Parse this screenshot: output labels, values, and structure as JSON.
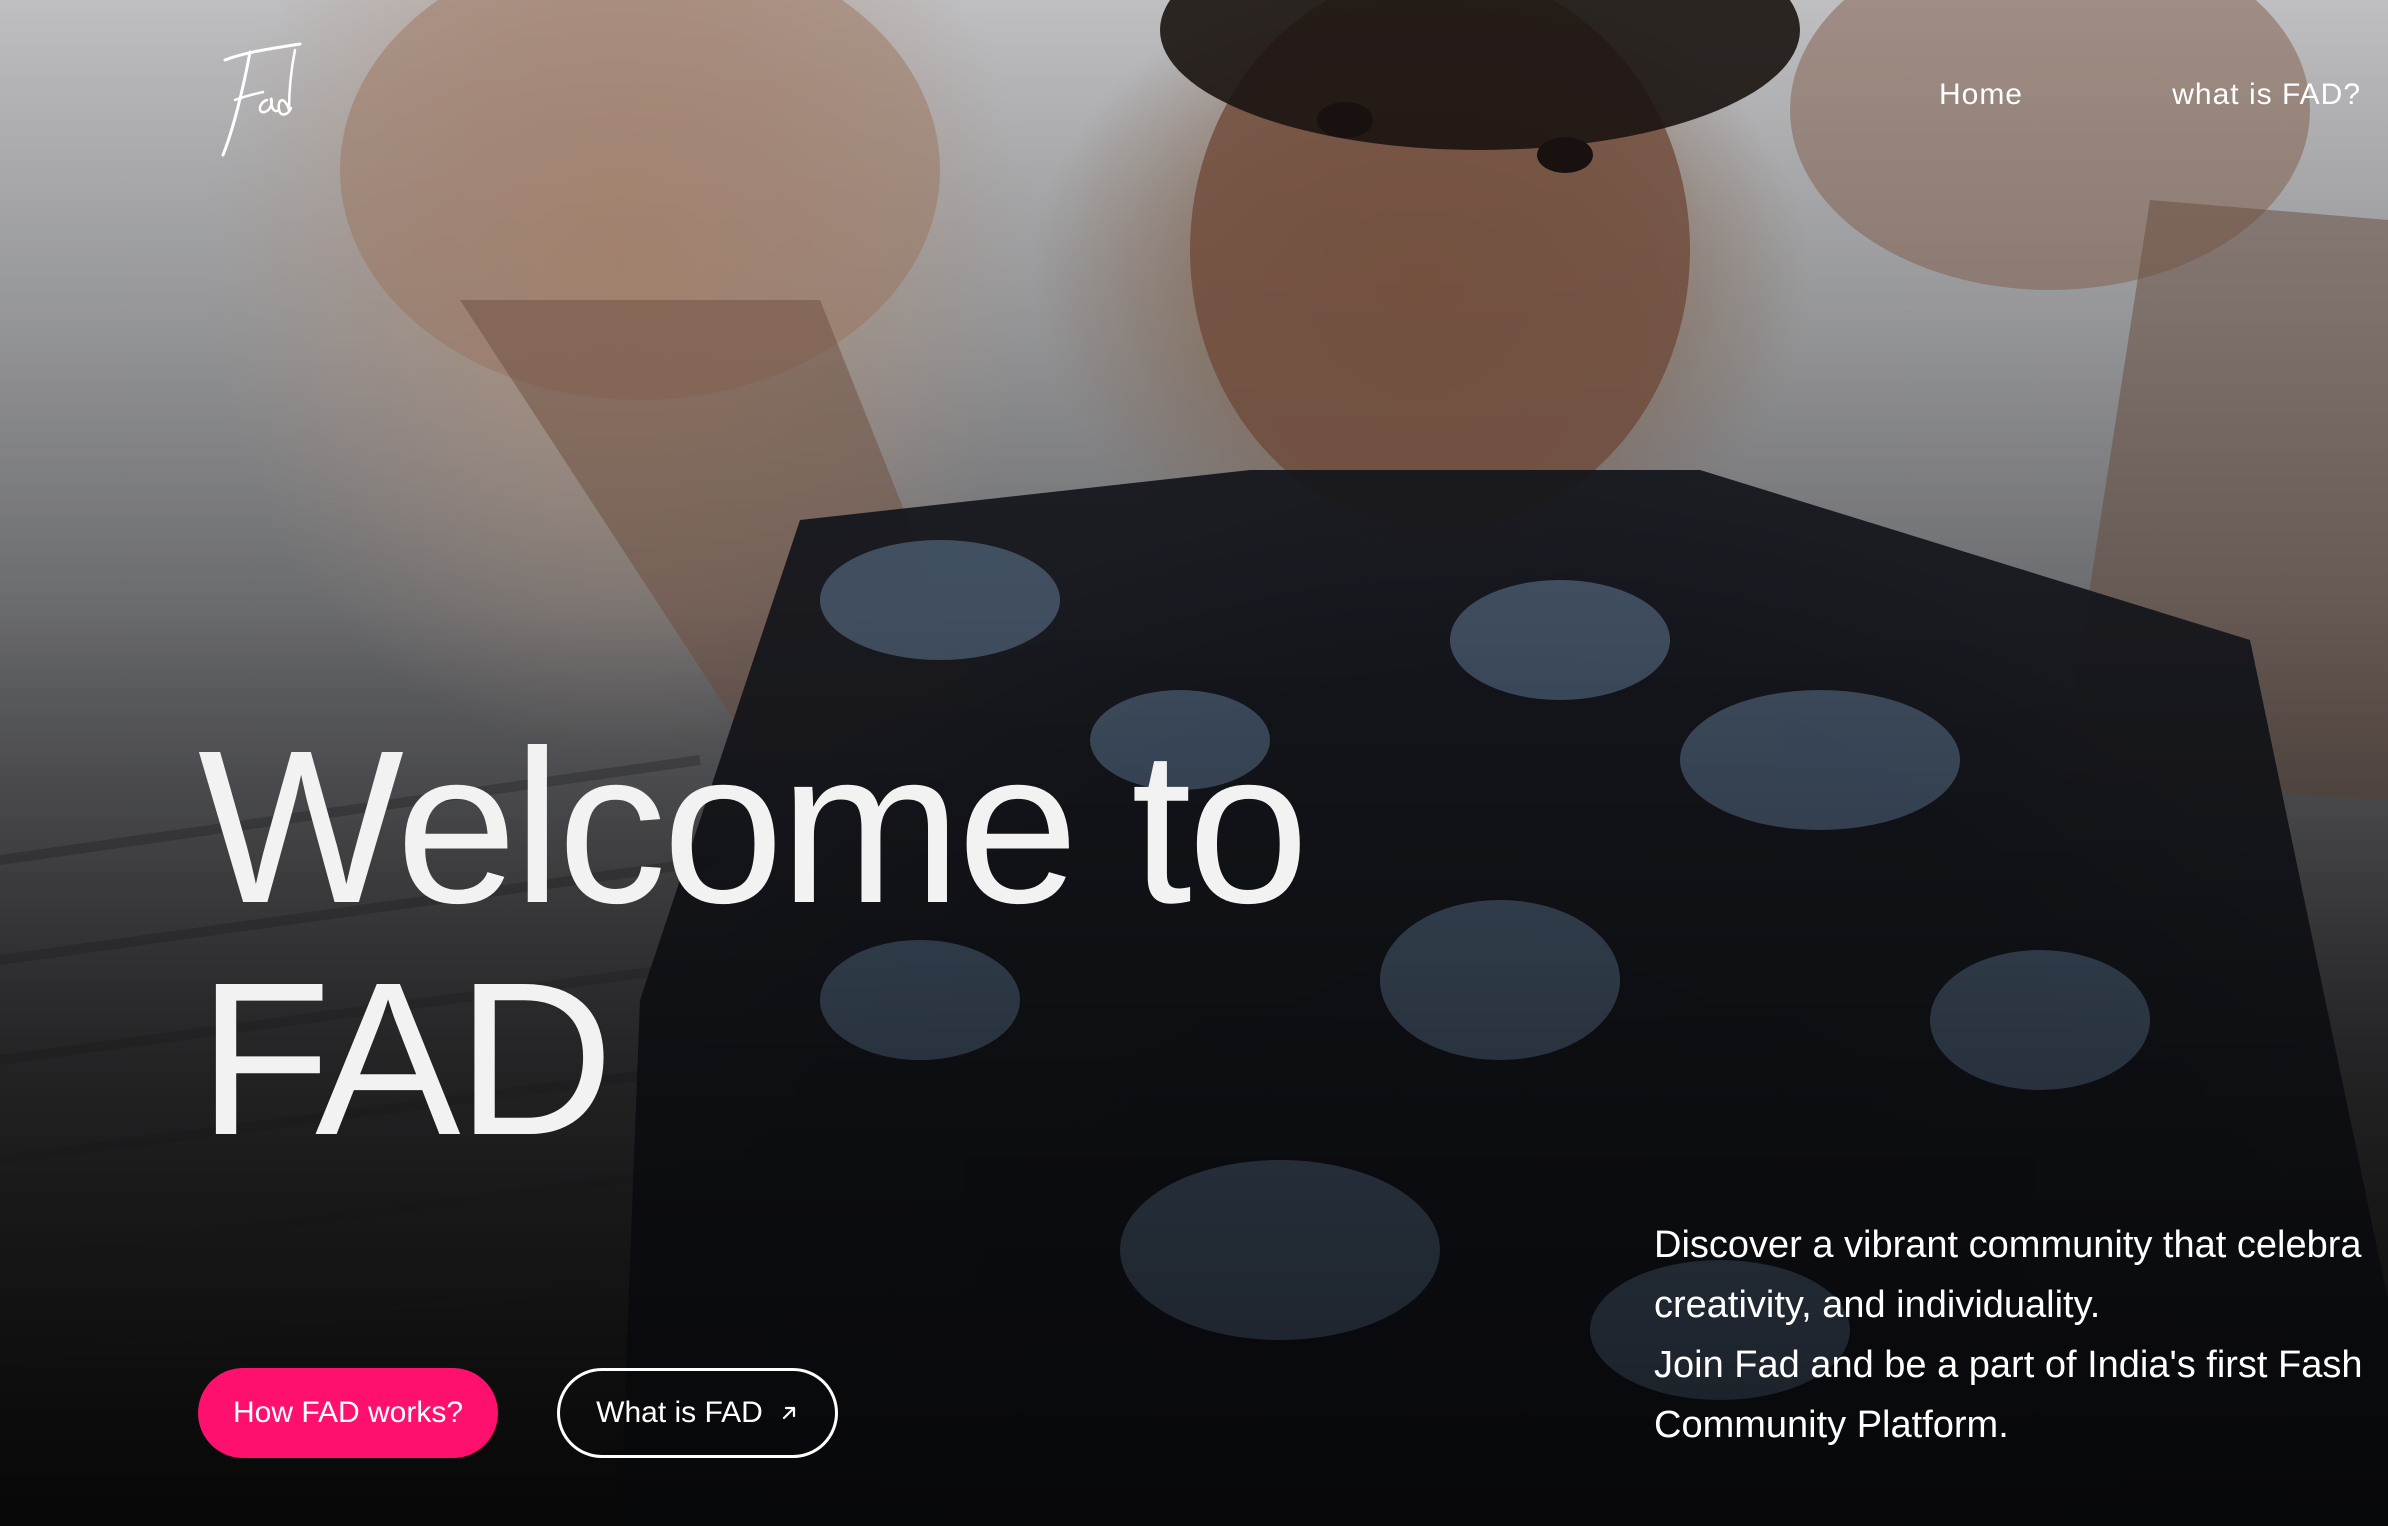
{
  "logo": {
    "text": "Fad",
    "icon": "fad-script-logo"
  },
  "nav": {
    "items": [
      {
        "label": "Home"
      },
      {
        "label": "what is FAD?"
      }
    ]
  },
  "hero": {
    "headline_line1": "Welcome to",
    "headline_line2": "FAD",
    "primary_button": "How FAD works?",
    "secondary_button": "What is FAD",
    "secondary_icon": "arrow-up-right-icon",
    "description_lines": [
      "Discover a vibrant community that celebra",
      "creativity, and individuality.",
      "Join Fad and be a part of India's first Fash",
      "Community Platform."
    ]
  },
  "colors": {
    "accent": "#ff0f6e",
    "text": "#ffffff"
  }
}
